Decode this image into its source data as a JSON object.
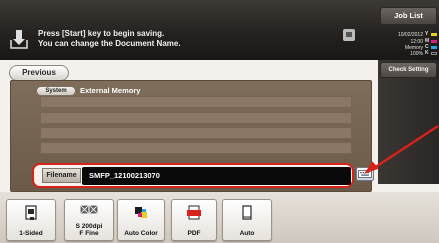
{
  "header": {
    "message_line1": "Press [Start] key to begin saving.",
    "message_line2": "You can change the Document Name.",
    "job_list_label": "Job List",
    "check_setting_label": "Check Setting",
    "status": {
      "date": "10/02/2012",
      "time": "12:00",
      "memory_label": "Memory",
      "memory_value": "100%"
    },
    "toner": [
      {
        "label": "Y",
        "color": "#e6d21e"
      },
      {
        "label": "M",
        "color": "#d4217f"
      },
      {
        "label": "C",
        "color": "#2aa7df"
      },
      {
        "label": "K",
        "color": "#1b1b1b"
      }
    ]
  },
  "nav": {
    "previous_label": "Previous"
  },
  "panel": {
    "system_label": "System",
    "location_label": "External Memory"
  },
  "filename": {
    "label": "Filename",
    "value": "SMFP_12100213070"
  },
  "toolbar": [
    {
      "label_line1": "1-Sided",
      "label_line2": "",
      "icon": "single-sided-icon"
    },
    {
      "label_line1": "S 200dpi",
      "label_line2": "F Fine",
      "icon": "resolution-icon"
    },
    {
      "label_line1": "Auto Color",
      "label_line2": "",
      "icon": "auto-color-icon"
    },
    {
      "label_line1": "PDF",
      "label_line2": "",
      "icon": "pdf-file-icon"
    },
    {
      "label_line1": "Auto",
      "label_line2": "",
      "icon": "scan-size-icon"
    }
  ],
  "colors": {
    "header_bg": "#23201e",
    "panel_bg": "#7e6d5a",
    "highlight": "#d9211c"
  }
}
